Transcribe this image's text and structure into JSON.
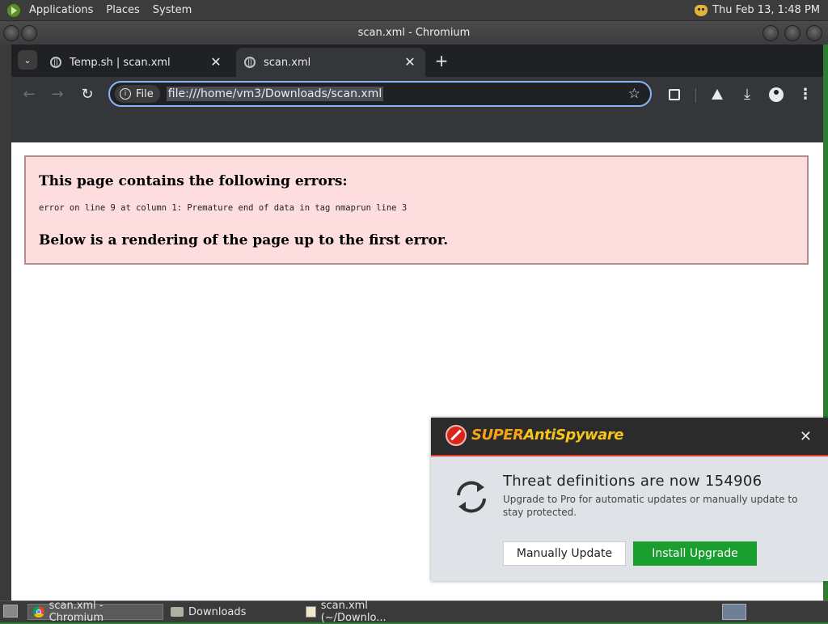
{
  "top_panel": {
    "menus": [
      "Applications",
      "Places",
      "System"
    ],
    "clock": "Thu Feb 13,  1:48 PM"
  },
  "window": {
    "title": "scan.xml - Chromium"
  },
  "browser": {
    "tabs": [
      {
        "label": "Temp.sh | scan.xml",
        "active": false
      },
      {
        "label": "scan.xml",
        "active": true
      }
    ],
    "tab_close_glyph": "✕",
    "new_tab_glyph": "+",
    "site_chip_label": "File",
    "url": "file:///home/vm3/Downloads/scan.xml"
  },
  "page": {
    "error_title": "This page contains the following errors:",
    "error_message": "error on line 9 at column 1: Premature end of data in tag nmaprun line 3",
    "error_footer": "Below is a rendering of the page up to the first error."
  },
  "popup": {
    "brand_prefix": "SUPER",
    "brand_rest": "AntiSpyware",
    "headline": "Threat definitions are now 154906",
    "description": "Upgrade to Pro for automatic updates or manually update to stay protected.",
    "buttons": {
      "manual": "Manually Update",
      "install": "Install Upgrade"
    },
    "colors": {
      "install_button": "#1a9e2e",
      "header": "#2b2b2b",
      "accent": "#e23b2e"
    }
  },
  "taskbar": {
    "items": [
      {
        "label": "scan.xml - Chromium",
        "icon": "chromium-icon",
        "active": true
      },
      {
        "label": "Downloads",
        "icon": "folder-icon",
        "active": false
      },
      {
        "label": "scan.xml (~/Downlo...",
        "icon": "text-editor-icon",
        "active": false
      }
    ]
  }
}
